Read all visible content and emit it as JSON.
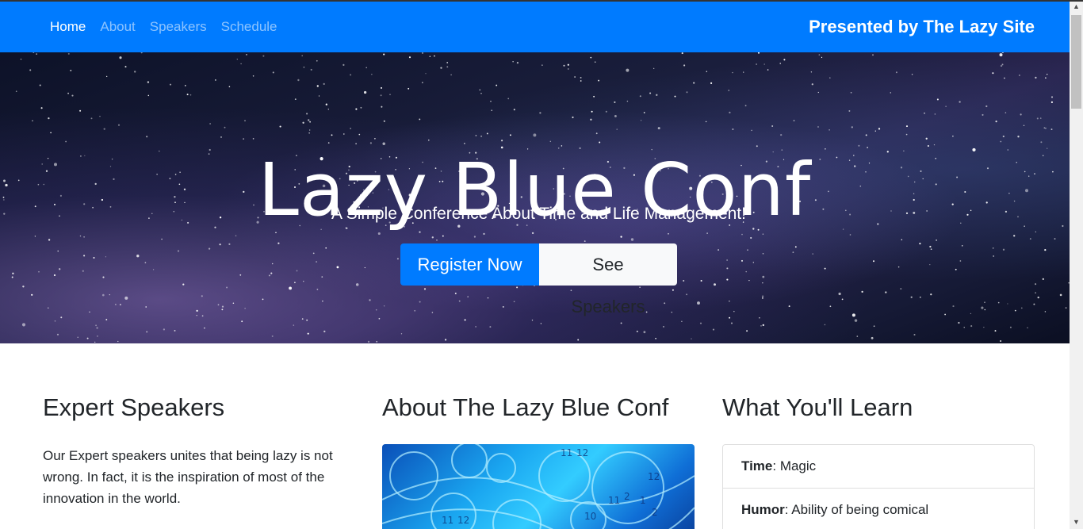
{
  "nav": {
    "links": [
      {
        "label": "Home"
      },
      {
        "label": "About"
      },
      {
        "label": "Speakers"
      },
      {
        "label": "Schedule"
      }
    ],
    "brand": "Presented by The Lazy Site",
    "color": "#007bff"
  },
  "hero": {
    "title": "Lazy Blue Conf",
    "subtitle": "A Simple Conference About Time and Life Management!",
    "primary_button": "Register Now",
    "secondary_button": "See Speakers"
  },
  "sections": {
    "speakers": {
      "heading": "Expert Speakers",
      "text": "Our Expert speakers unites that being lazy is not wrong. In fact, it is the inspiration of most of the innovation in the world."
    },
    "about": {
      "heading": "About The Lazy Blue Conf",
      "image_icon": "clock-image"
    },
    "learn": {
      "heading": "What You'll Learn",
      "items": [
        {
          "term": "Time",
          "desc": ": Magic"
        },
        {
          "term": "Humor",
          "desc": ": Ability of being comical"
        }
      ]
    }
  }
}
